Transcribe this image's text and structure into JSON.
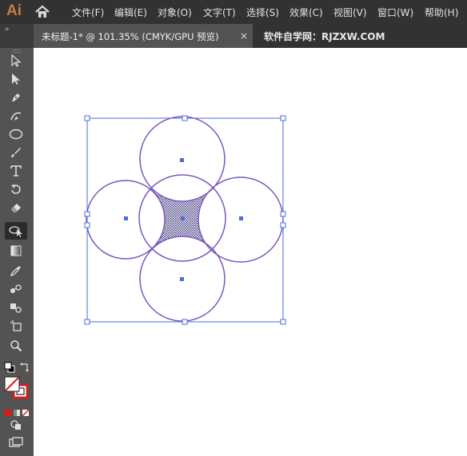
{
  "app": {
    "logo": "Ai"
  },
  "menu": [
    {
      "label": "文件(F)"
    },
    {
      "label": "编辑(E)"
    },
    {
      "label": "对象(O)"
    },
    {
      "label": "文字(T)"
    },
    {
      "label": "选择(S)"
    },
    {
      "label": "效果(C)"
    },
    {
      "label": "视图(V)"
    },
    {
      "label": "窗口(W)"
    },
    {
      "label": "帮助(H)"
    }
  ],
  "document": {
    "tab_title": "未标题-1* @ 101.35% (CMYK/GPU 预览)",
    "close_glyph": "×"
  },
  "watermark": "软件自学网：RJZXW.COM",
  "toolbar": {
    "collapse_glyph": "»",
    "tools": [
      {
        "name": "selection-tool-icon"
      },
      {
        "name": "direct-selection-tool-icon"
      },
      {
        "name": "pen-tool-icon"
      },
      {
        "name": "curvature-tool-icon"
      },
      {
        "name": "ellipse-tool-icon"
      },
      {
        "name": "paintbrush-tool-icon"
      },
      {
        "name": "type-tool-icon"
      },
      {
        "name": "rotate-tool-icon"
      },
      {
        "name": "eraser-tool-icon"
      },
      {
        "name": "lasso-shape-builder-tool-icon",
        "active": true
      },
      {
        "name": "gradient-tool-icon"
      },
      {
        "name": "eyedropper-tool-icon"
      },
      {
        "name": "blend-tool-icon"
      },
      {
        "name": "symbol-sprayer-tool-icon"
      },
      {
        "name": "artboard-tool-icon"
      },
      {
        "name": "zoom-tool-icon"
      }
    ]
  },
  "colors": {
    "menubar_bg": "#323232",
    "panel_bg": "#535353",
    "selection_blue": "#4a6fd6",
    "circle_stroke": "#7b55c0",
    "fill_stroke_red": "#d61e1e"
  }
}
